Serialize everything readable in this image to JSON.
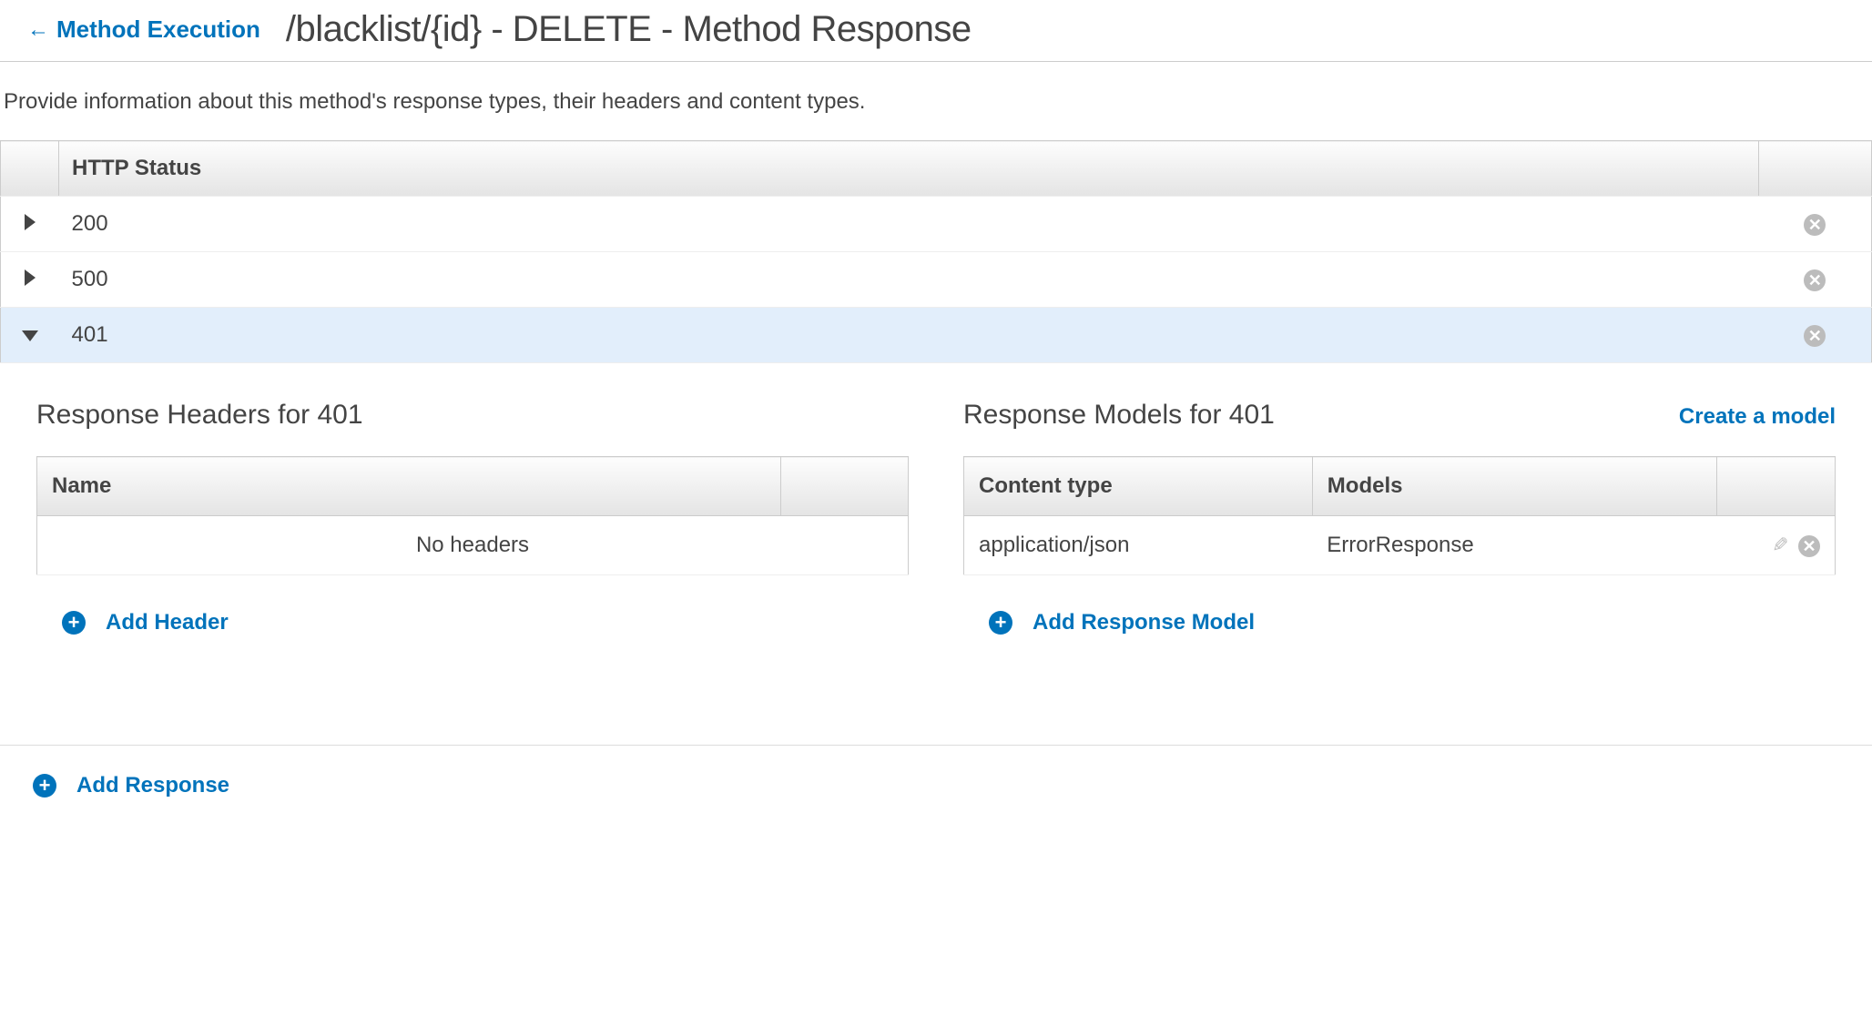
{
  "header": {
    "back_label": "Method Execution",
    "title": "/blacklist/{id} - DELETE - Method Response"
  },
  "description": "Provide information about this method's response types, their headers and content types.",
  "status_table": {
    "header": "HTTP Status",
    "rows": [
      {
        "code": "200",
        "expanded": false
      },
      {
        "code": "500",
        "expanded": false
      },
      {
        "code": "401",
        "expanded": true
      }
    ]
  },
  "panels": {
    "headers": {
      "title": "Response Headers for 401",
      "col_name": "Name",
      "empty_text": "No headers",
      "add_label": "Add Header"
    },
    "models": {
      "title": "Response Models for 401",
      "create_label": "Create a model",
      "col_content_type": "Content type",
      "col_models": "Models",
      "rows": [
        {
          "content_type": "application/json",
          "model": "ErrorResponse"
        }
      ],
      "add_label": "Add Response Model"
    }
  },
  "footer": {
    "add_response_label": "Add Response"
  }
}
